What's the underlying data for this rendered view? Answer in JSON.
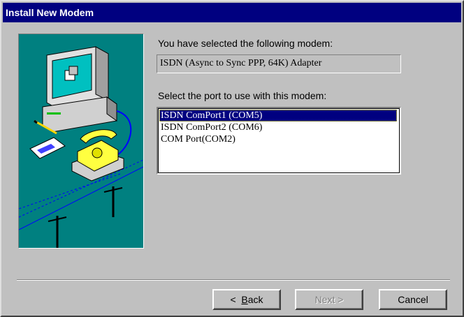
{
  "window": {
    "title": "Install New Modem"
  },
  "main": {
    "selected_label": "You have selected the following modem:",
    "modem_name": "ISDN (Async to Sync PPP, 64K) Adapter",
    "port_label": "Select the port to use with this modem:",
    "ports": [
      {
        "label": "ISDN ComPort1 (COM5)",
        "selected": true
      },
      {
        "label": "ISDN ComPort2 (COM6)",
        "selected": false
      },
      {
        "label": "COM Port(COM2)",
        "selected": false
      }
    ]
  },
  "buttons": {
    "back_arrow": "<",
    "back_prefix": "",
    "back_mnemonic": "B",
    "back_rest": "ack",
    "next_label": "Next >",
    "cancel_label": "Cancel"
  },
  "colors": {
    "titlebar": "#000080",
    "dialog": "#c0c0c0",
    "illustration_bg": "#008080",
    "selection": "#000080"
  },
  "icons": {
    "illustration": "computer-phone-modem-illustration"
  }
}
